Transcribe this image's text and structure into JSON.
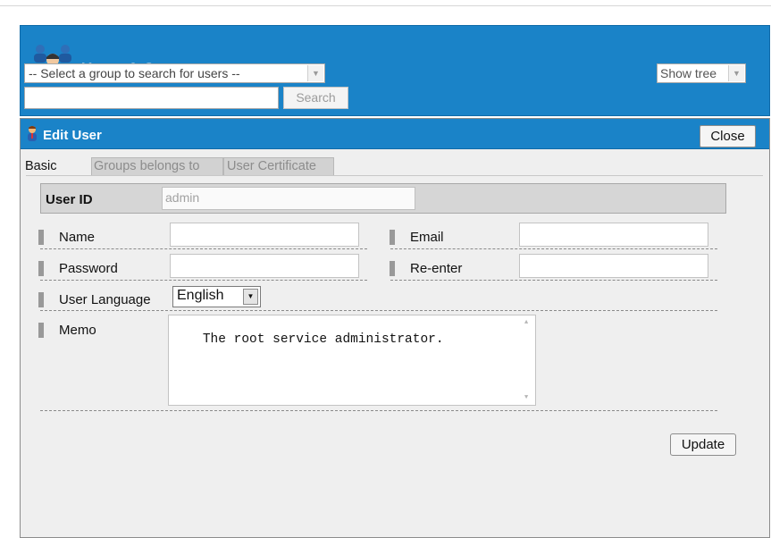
{
  "header": {
    "title": "Users & Groups",
    "group_select": {
      "value": "-- Select a group to search for users --"
    },
    "search_input": {
      "value": ""
    },
    "search_label": "Search",
    "show_tree": {
      "value": "Show tree"
    }
  },
  "edit_user": {
    "title": "Edit User",
    "close_label": "Close",
    "tabs": [
      {
        "label": "Basic",
        "active": true
      },
      {
        "label": "Groups belongs to",
        "active": false
      },
      {
        "label": "User Certificate",
        "active": false
      }
    ],
    "user_id": {
      "label": "User ID",
      "value": "admin"
    },
    "fields": {
      "name": {
        "label": "Name",
        "value": ""
      },
      "email": {
        "label": "Email",
        "value": ""
      },
      "password": {
        "label": "Password",
        "value": ""
      },
      "reenter": {
        "label": "Re-enter",
        "value": ""
      }
    },
    "language": {
      "label": "User Language",
      "value": "English"
    },
    "memo": {
      "label": "Memo",
      "value": "The root service administrator."
    },
    "update_label": "Update"
  },
  "colors": {
    "header_blue": "#1a83c8",
    "panel_bg": "#efefef",
    "row_bg": "#d6d6d6"
  },
  "icons": {
    "header": "users-groups-icon",
    "edit": "user-icon",
    "dropdown": "chevron-down-icon"
  }
}
